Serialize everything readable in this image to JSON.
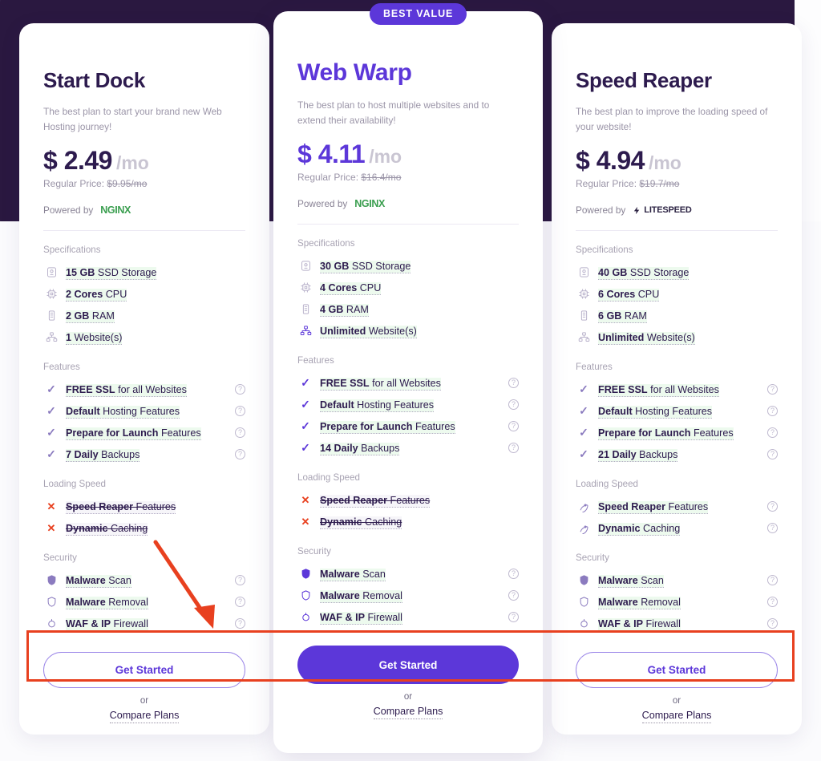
{
  "badge": {
    "label": "BEST VALUE"
  },
  "labels": {
    "powered_by": "Powered by",
    "specifications": "Specifications",
    "features": "Features",
    "loading_speed": "Loading Speed",
    "security": "Security",
    "or": "or",
    "compare_plans": "Compare Plans",
    "get_started": "Get Started",
    "regular_price_prefix": "Regular Price:",
    "help": "?"
  },
  "colors": {
    "brand_purple": "#5c37d9",
    "dark_heading": "#2d1b4e",
    "dark_band": "#2a1840",
    "nginx_green": "#3a9e4f",
    "annotation_red": "#e8401f",
    "muted_text": "#9b95a8"
  },
  "plans": [
    {
      "name": "Start Dock",
      "description": "The best plan to start your brand new Web Hosting journey!",
      "price": "$ 2.49",
      "per": "/mo",
      "regular_price": "$9.95/mo",
      "powered_logo": "NGINX",
      "specs": [
        {
          "icon": "ssd-storage-icon",
          "value": "15 GB",
          "label": "SSD Storage"
        },
        {
          "icon": "cpu-icon",
          "value": "2 Cores",
          "label": "CPU"
        },
        {
          "icon": "ram-icon",
          "value": "2 GB",
          "label": "RAM"
        },
        {
          "icon": "websites-icon",
          "value": "1",
          "label": "Website(s)"
        }
      ],
      "features": [
        {
          "icon": "check-icon",
          "value": "FREE SSL",
          "label": "for all Websites",
          "help": true
        },
        {
          "icon": "check-icon",
          "value": "Default",
          "label": "Hosting Features",
          "help": true
        },
        {
          "icon": "check-icon",
          "value": "Prepare for Launch",
          "label": "Features",
          "help": true
        },
        {
          "icon": "check-icon",
          "value": "7 Daily",
          "label": "Backups",
          "help": true
        }
      ],
      "loading_speed": [
        {
          "icon": "x-icon",
          "value": "Speed Reaper",
          "label": "Features",
          "help": false,
          "struck": true
        },
        {
          "icon": "x-icon",
          "value": "Dynamic",
          "label": "Caching",
          "help": false,
          "struck": true
        }
      ],
      "security": [
        {
          "icon": "shield-icon",
          "value": "Malware",
          "label": "Scan",
          "help": true
        },
        {
          "icon": "shield-outline-icon",
          "value": "Malware",
          "label": "Removal",
          "help": true
        },
        {
          "icon": "firewall-icon",
          "value": "WAF & IP",
          "label": "Firewall",
          "help": true
        }
      ],
      "cta": "Get Started",
      "cta_style": "outline"
    },
    {
      "name": "Web Warp",
      "description": "The best plan to host multiple websites and to extend their availability!",
      "price": "$ 4.11",
      "per": "/mo",
      "regular_price": "$16.4/mo",
      "powered_logo": "NGINX",
      "specs": [
        {
          "icon": "ssd-storage-icon",
          "value": "30 GB",
          "label": "SSD Storage"
        },
        {
          "icon": "cpu-icon",
          "value": "4 Cores",
          "label": "CPU"
        },
        {
          "icon": "ram-icon",
          "value": "4 GB",
          "label": "RAM"
        },
        {
          "icon": "websites-icon",
          "value": "Unlimited",
          "label": "Website(s)"
        }
      ],
      "features": [
        {
          "icon": "check-icon",
          "value": "FREE SSL",
          "label": "for all Websites",
          "help": true
        },
        {
          "icon": "check-icon",
          "value": "Default",
          "label": "Hosting Features",
          "help": true
        },
        {
          "icon": "check-icon",
          "value": "Prepare for Launch",
          "label": "Features",
          "help": true
        },
        {
          "icon": "check-icon",
          "value": "14 Daily",
          "label": "Backups",
          "help": true
        }
      ],
      "loading_speed": [
        {
          "icon": "x-icon",
          "value": "Speed Reaper",
          "label": "Features",
          "help": false,
          "struck": true
        },
        {
          "icon": "x-icon",
          "value": "Dynamic",
          "label": "Caching",
          "help": false,
          "struck": true
        }
      ],
      "security": [
        {
          "icon": "shield-icon",
          "value": "Malware",
          "label": "Scan",
          "help": true
        },
        {
          "icon": "shield-outline-icon",
          "value": "Malware",
          "label": "Removal",
          "help": true
        },
        {
          "icon": "firewall-icon",
          "value": "WAF & IP",
          "label": "Firewall",
          "help": true
        }
      ],
      "cta": "Get Started",
      "cta_style": "filled"
    },
    {
      "name": "Speed Reaper",
      "description": "The best plan to improve the loading speed of your website!",
      "price": "$ 4.94",
      "per": "/mo",
      "regular_price": "$19.7/mo",
      "powered_logo": "LITESPEED",
      "specs": [
        {
          "icon": "ssd-storage-icon",
          "value": "40 GB",
          "label": "SSD Storage"
        },
        {
          "icon": "cpu-icon",
          "value": "6 Cores",
          "label": "CPU"
        },
        {
          "icon": "ram-icon",
          "value": "6 GB",
          "label": "RAM"
        },
        {
          "icon": "websites-icon",
          "value": "Unlimited",
          "label": "Website(s)"
        }
      ],
      "features": [
        {
          "icon": "check-icon",
          "value": "FREE SSL",
          "label": "for all Websites",
          "help": true
        },
        {
          "icon": "check-icon",
          "value": "Default",
          "label": "Hosting Features",
          "help": true
        },
        {
          "icon": "check-icon",
          "value": "Prepare for Launch",
          "label": "Features",
          "help": true
        },
        {
          "icon": "check-icon",
          "value": "21 Daily",
          "label": "Backups",
          "help": true
        }
      ],
      "loading_speed": [
        {
          "icon": "rocket-icon",
          "value": "Speed Reaper",
          "label": "Features",
          "help": true,
          "struck": false
        },
        {
          "icon": "rocket-icon",
          "value": "Dynamic",
          "label": "Caching",
          "help": true,
          "struck": false
        }
      ],
      "security": [
        {
          "icon": "shield-icon",
          "value": "Malware",
          "label": "Scan",
          "help": true
        },
        {
          "icon": "shield-outline-icon",
          "value": "Malware",
          "label": "Removal",
          "help": true
        },
        {
          "icon": "firewall-icon",
          "value": "WAF & IP",
          "label": "Firewall",
          "help": true
        }
      ],
      "cta": "Get Started",
      "cta_style": "outline"
    }
  ],
  "annotations": [
    {
      "type": "rectangle",
      "color": "#e8401f",
      "target": "get-started-buttons-row"
    },
    {
      "type": "arrow",
      "color": "#e8401f",
      "target": "get-started-button-plan-1"
    }
  ]
}
